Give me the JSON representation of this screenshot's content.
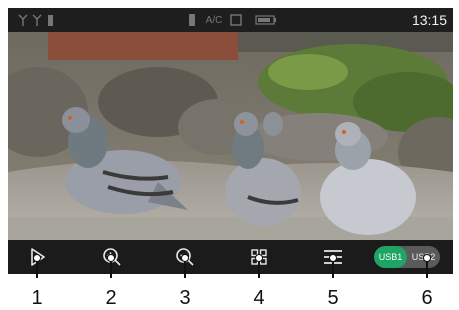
{
  "status_bar": {
    "time": "13:15",
    "icons": [
      "antenna-icon",
      "antenna-icon",
      "signal-icon",
      "phone-icon",
      "ac-icon",
      "window-icon",
      "battery-icon"
    ],
    "ac_text": "A/C"
  },
  "photo": {
    "subject": "pigeons-photo"
  },
  "controls": {
    "items": [
      {
        "icon": "play-icon"
      },
      {
        "icon": "zoom-in-icon"
      },
      {
        "icon": "zoom-out-icon"
      },
      {
        "icon": "grid-view-icon"
      },
      {
        "icon": "menu-icon"
      }
    ],
    "usb1": "USB1",
    "usb2": "USB2",
    "active_source": "USB1"
  },
  "callouts": [
    "1",
    "2",
    "3",
    "4",
    "5",
    "6"
  ],
  "colors": {
    "accent": "#1fa463",
    "bar": "#1b1b1b"
  }
}
